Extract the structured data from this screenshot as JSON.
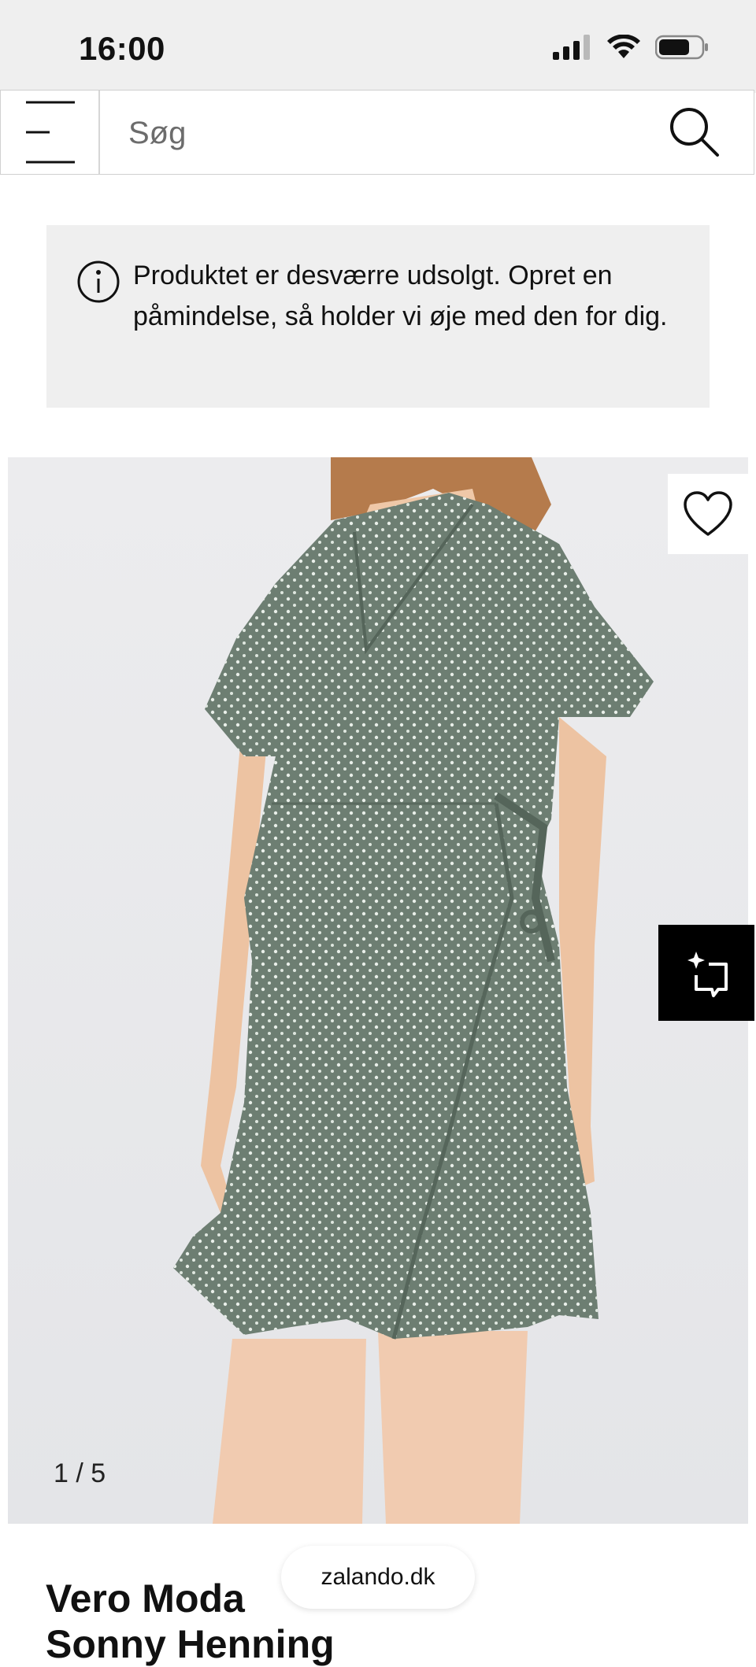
{
  "status_bar": {
    "time": "16:00"
  },
  "search": {
    "placeholder": "Søg"
  },
  "notice": {
    "text": "Produktet er desværre udsolgt. Opret en påmindelse, så holder vi øje med den for dig."
  },
  "gallery": {
    "counter": "1 / 5",
    "current": 1,
    "total": 5
  },
  "product": {
    "brand": "Vero Moda",
    "name_peek": "Sonny Henning"
  },
  "browser": {
    "url": "zalando.dk"
  },
  "icons": {
    "menu": "menu-icon",
    "search": "search-icon",
    "info": "info-icon",
    "wishlist": "heart-icon",
    "similar": "find-similar-icon"
  },
  "colors": {
    "dress": "#6d7e72",
    "background": "#e8e9ec",
    "notice_bg": "#efefef"
  }
}
